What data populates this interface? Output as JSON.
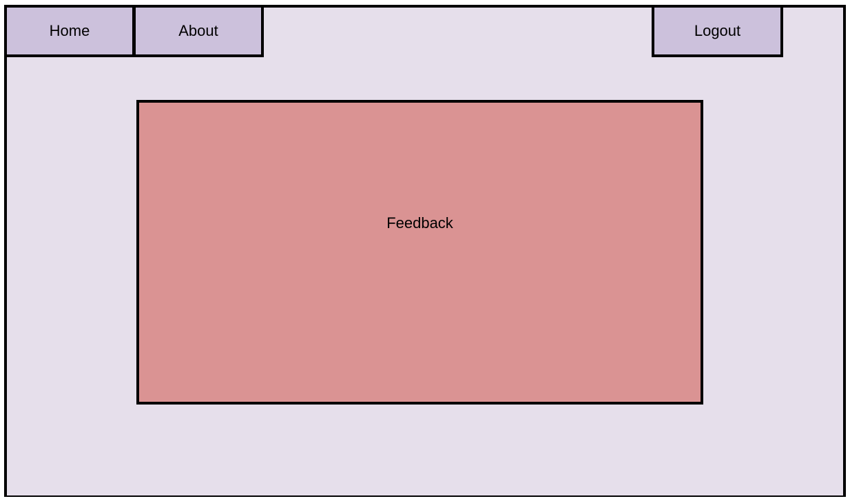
{
  "nav": {
    "home_label": "Home",
    "about_label": "About",
    "logout_label": "Logout"
  },
  "main": {
    "feedback_label": "Feedback"
  },
  "colors": {
    "background": "#e6dfeb",
    "tab": "#ccc1dc",
    "feedback_panel": "#da9393",
    "border": "#000000"
  }
}
